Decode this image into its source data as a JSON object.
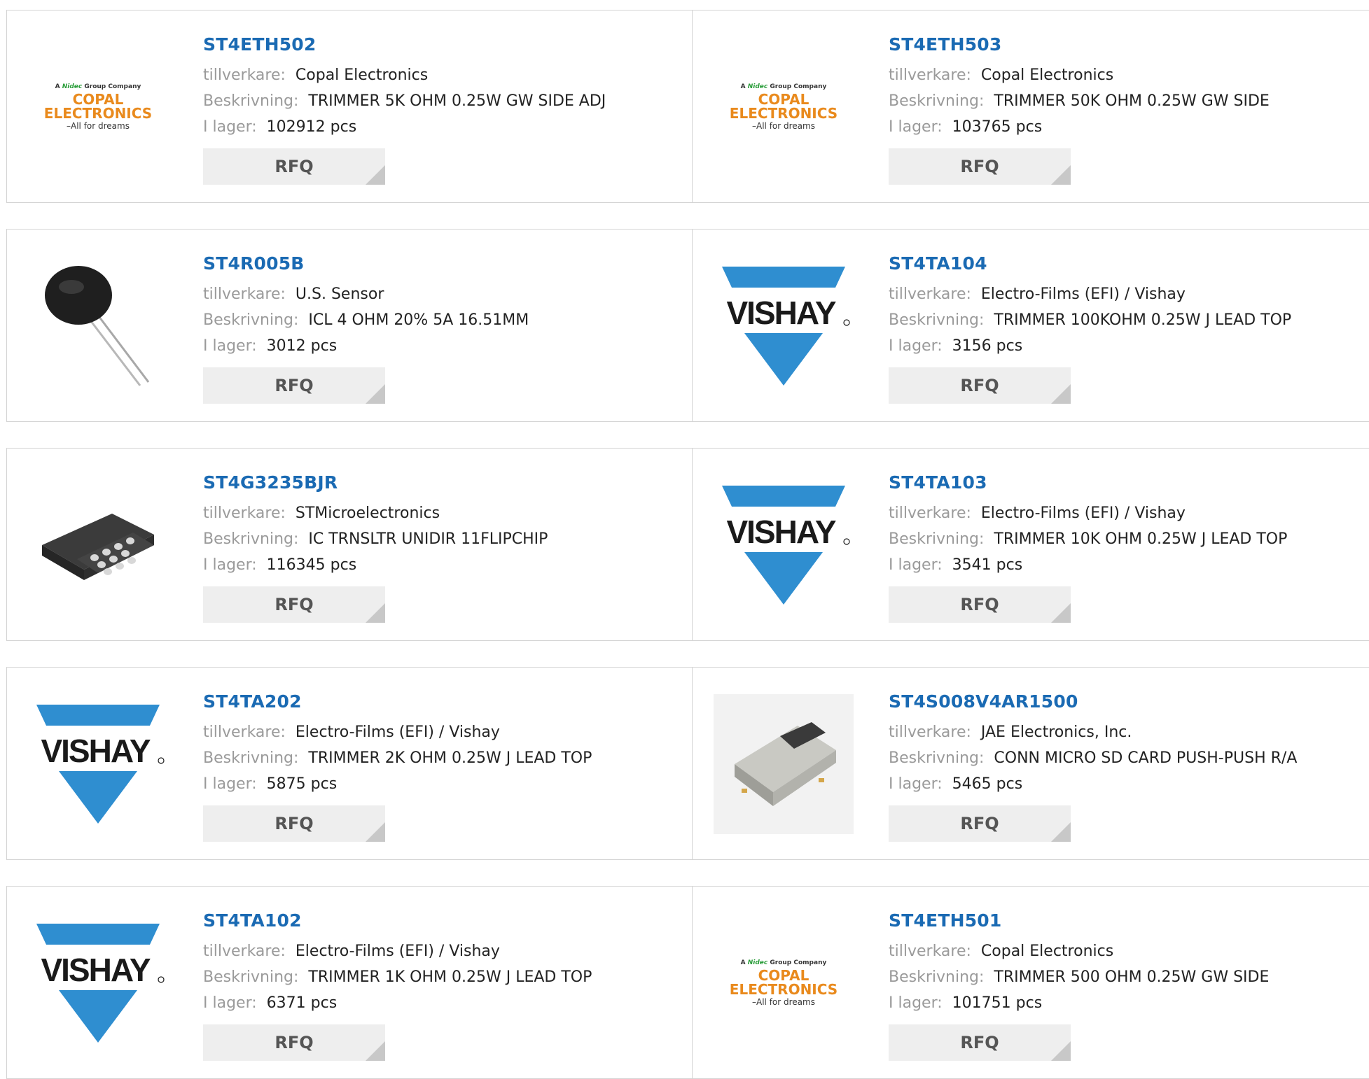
{
  "labels": {
    "manufacturer": "tillverkare:",
    "description": "Beskrivning:",
    "stock": "I lager:",
    "rfq": "RFQ"
  },
  "logo_text": {
    "copal_top_prefix": "A",
    "copal_top_brand": "Nidec",
    "copal_top_suffix": "Group Company",
    "copal_main": "COPAL ELECTRONICS",
    "copal_tagline": "–All for dreams",
    "vishay": "VISHAY"
  },
  "colors": {
    "link": "#1a6ab3",
    "vishay_blue": "#2f8ed0",
    "copal_orange": "#e98a1d"
  },
  "products": [
    {
      "part": "ST4ETH502",
      "manufacturer": "Copal Electronics",
      "description": "TRIMMER 5K OHM 0.25W GW SIDE ADJ",
      "stock": "102912 pcs",
      "image": "copal-logo"
    },
    {
      "part": "ST4ETH503",
      "manufacturer": "Copal Electronics",
      "description": "TRIMMER 50K OHM 0.25W GW SIDE",
      "stock": "103765 pcs",
      "image": "copal-logo"
    },
    {
      "part": "ST4R005B",
      "manufacturer": "U.S. Sensor",
      "description": "ICL 4 OHM 20% 5A 16.51MM",
      "stock": "3012 pcs",
      "image": "thermistor-photo"
    },
    {
      "part": "ST4TA104",
      "manufacturer": "Electro-Films (EFI) / Vishay",
      "description": "TRIMMER 100KOHM 0.25W J LEAD TOP",
      "stock": "3156 pcs",
      "image": "vishay-logo"
    },
    {
      "part": "ST4G3235BJR",
      "manufacturer": "STMicroelectronics",
      "description": "IC TRNSLTR UNIDIR 11FLIPCHIP",
      "stock": "116345 pcs",
      "image": "flipchip-photo"
    },
    {
      "part": "ST4TA103",
      "manufacturer": "Electro-Films (EFI) / Vishay",
      "description": "TRIMMER 10K OHM 0.25W J LEAD TOP",
      "stock": "3541 pcs",
      "image": "vishay-logo"
    },
    {
      "part": "ST4TA202",
      "manufacturer": "Electro-Films (EFI) / Vishay",
      "description": "TRIMMER 2K OHM 0.25W J LEAD TOP",
      "stock": "5875 pcs",
      "image": "vishay-logo"
    },
    {
      "part": "ST4S008V4AR1500",
      "manufacturer": "JAE Electronics, Inc.",
      "description": "CONN MICRO SD CARD PUSH-PUSH R/A",
      "stock": "5465 pcs",
      "image": "sd-connector-photo"
    },
    {
      "part": "ST4TA102",
      "manufacturer": "Electro-Films (EFI) / Vishay",
      "description": "TRIMMER 1K OHM 0.25W J LEAD TOP",
      "stock": "6371 pcs",
      "image": "vishay-logo"
    },
    {
      "part": "ST4ETH501",
      "manufacturer": "Copal Electronics",
      "description": "TRIMMER 500 OHM 0.25W GW SIDE",
      "stock": "101751 pcs",
      "image": "copal-logo"
    }
  ]
}
